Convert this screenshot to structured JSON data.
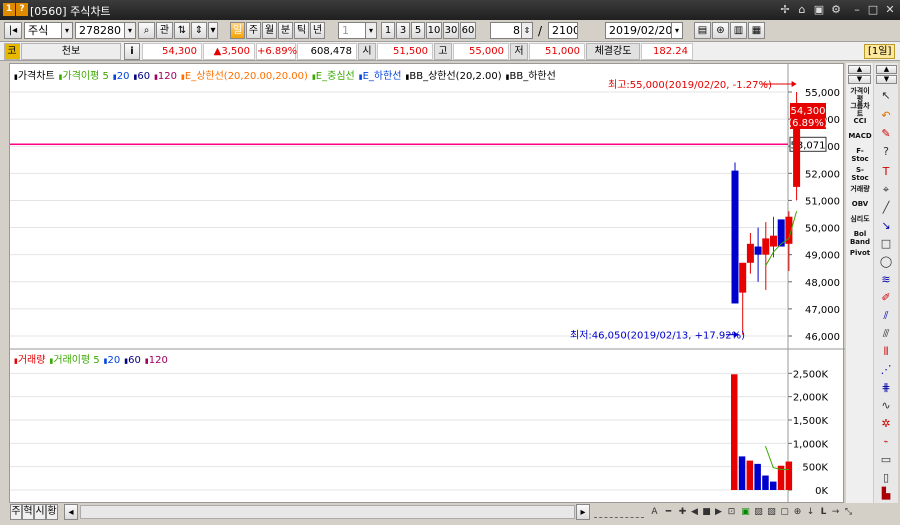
{
  "window": {
    "title": "[0560] 주식차트",
    "icon_1": "1",
    "icon_2": "?"
  },
  "toolbar": {
    "market_select": "주식",
    "code_value": "278280",
    "search_label": "⌕",
    "compare_label": "관",
    "period_buttons": [
      "일",
      "주",
      "월",
      "분",
      "틱",
      "년"
    ],
    "active_period": "일",
    "interval_value": "1",
    "minute_buttons": [
      "1",
      "3",
      "5",
      "10",
      "30",
      "60"
    ],
    "count_value": "8",
    "total_value": "2100",
    "date_value": "2019/02/20"
  },
  "infobar": {
    "code_label": "코",
    "name": "천보",
    "info_button": "i",
    "price": "54,300",
    "change": "▲3,500",
    "change_pct": "+6.89%",
    "volume": "608,478",
    "open_label": "시",
    "open": "51,500",
    "high_label": "고",
    "high": "55,000",
    "low_label": "저",
    "low": "51,000",
    "strength_label": "체결강도",
    "strength": "182.24",
    "period_badge": "[1일]"
  },
  "price_panel": {
    "legend": [
      {
        "text": "가격차트",
        "color": "#000000"
      },
      {
        "text": "가격이평 5",
        "color": "#3aa800"
      },
      {
        "text": "20",
        "color": "#0044dd"
      },
      {
        "text": "60",
        "color": "#000080"
      },
      {
        "text": "120",
        "color": "#a00060"
      },
      {
        "text": "E_상한선(20,20.00,20.00)",
        "color": "#ff7000"
      },
      {
        "text": "E_중심선",
        "color": "#3aa800"
      },
      {
        "text": "E_하한선",
        "color": "#0044dd"
      },
      {
        "text": "BB_상한선(20,2.00)",
        "color": "#000000"
      },
      {
        "text": "BB_하한선",
        "color": "#000000"
      }
    ],
    "high_annotation": "최고:55,000(2019/02/20, -1.27%)",
    "low_annotation": "최저:46,050(2019/02/13, +17.92%)",
    "current_price_tag": "54,300",
    "current_pct_tag": "(6.89%)",
    "line_value_tag": "53,071",
    "line_color": "#ff0080",
    "up_color": "#e60000",
    "down_color": "#0000cc"
  },
  "volume_panel": {
    "legend": [
      {
        "text": "거래량",
        "color": "#e60000"
      },
      {
        "text": "거래이평 5",
        "color": "#3aa800"
      },
      {
        "text": "20",
        "color": "#0044dd"
      },
      {
        "text": "60",
        "color": "#000080"
      },
      {
        "text": "120",
        "color": "#a00060"
      }
    ]
  },
  "chart_data": [
    {
      "type": "candlestick",
      "title": "",
      "ylim": [
        46000,
        55000
      ],
      "y_ticks": [
        "55,000",
        "54,000",
        "53,000",
        "52,000",
        "51,000",
        "50,000",
        "49,000",
        "48,000",
        "47,000",
        "46,000"
      ],
      "y_tick_values": [
        55000,
        54000,
        53000,
        52000,
        51000,
        50000,
        49000,
        48000,
        47000,
        46000
      ],
      "candles": [
        {
          "open": 52100,
          "high": 52400,
          "low": 47200,
          "close": 47200
        },
        {
          "open": 47600,
          "high": 48700,
          "low": 46050,
          "close": 48700
        },
        {
          "open": 48700,
          "high": 49800,
          "low": 48300,
          "close": 49400
        },
        {
          "open": 49300,
          "high": 50000,
          "low": 48000,
          "close": 49000
        },
        {
          "open": 49000,
          "high": 50200,
          "low": 47700,
          "close": 49600
        },
        {
          "open": 49300,
          "high": 50400,
          "low": 48900,
          "close": 49700
        },
        {
          "open": 50300,
          "high": 50300,
          "low": 49300,
          "close": 49300
        },
        {
          "open": 49400,
          "high": 50600,
          "low": 48400,
          "close": 50400
        },
        {
          "open": 51500,
          "high": 55000,
          "low": 51000,
          "close": 54300
        }
      ],
      "ma5": [
        null,
        null,
        null,
        null,
        48600,
        49100,
        49400,
        49600,
        50600
      ],
      "reference_line": 53071
    },
    {
      "type": "bar",
      "title": "",
      "ylim": [
        0,
        2700
      ],
      "y_ticks": [
        "2,500K",
        "2,000K",
        "1,500K",
        "1,000K",
        "500K",
        "0K"
      ],
      "y_tick_values": [
        2500,
        2000,
        1500,
        1000,
        500,
        0
      ],
      "values": [
        2480,
        720,
        630,
        560,
        310,
        180,
        520,
        610
      ],
      "up": [
        true,
        false,
        true,
        false,
        false,
        false,
        true,
        true
      ],
      "ma5": [
        null,
        null,
        null,
        null,
        940,
        480,
        440,
        440
      ]
    }
  ],
  "right_tools": [
    "가격이평",
    "그룹차트",
    "CCI",
    "MACD",
    "F-Stoc",
    "S-Stoc",
    "거래량",
    "OBV",
    "심리도",
    "Bol Band",
    "Pivot"
  ],
  "bottom": {
    "tabs": [
      "주",
      "혁",
      "시",
      "황"
    ]
  }
}
